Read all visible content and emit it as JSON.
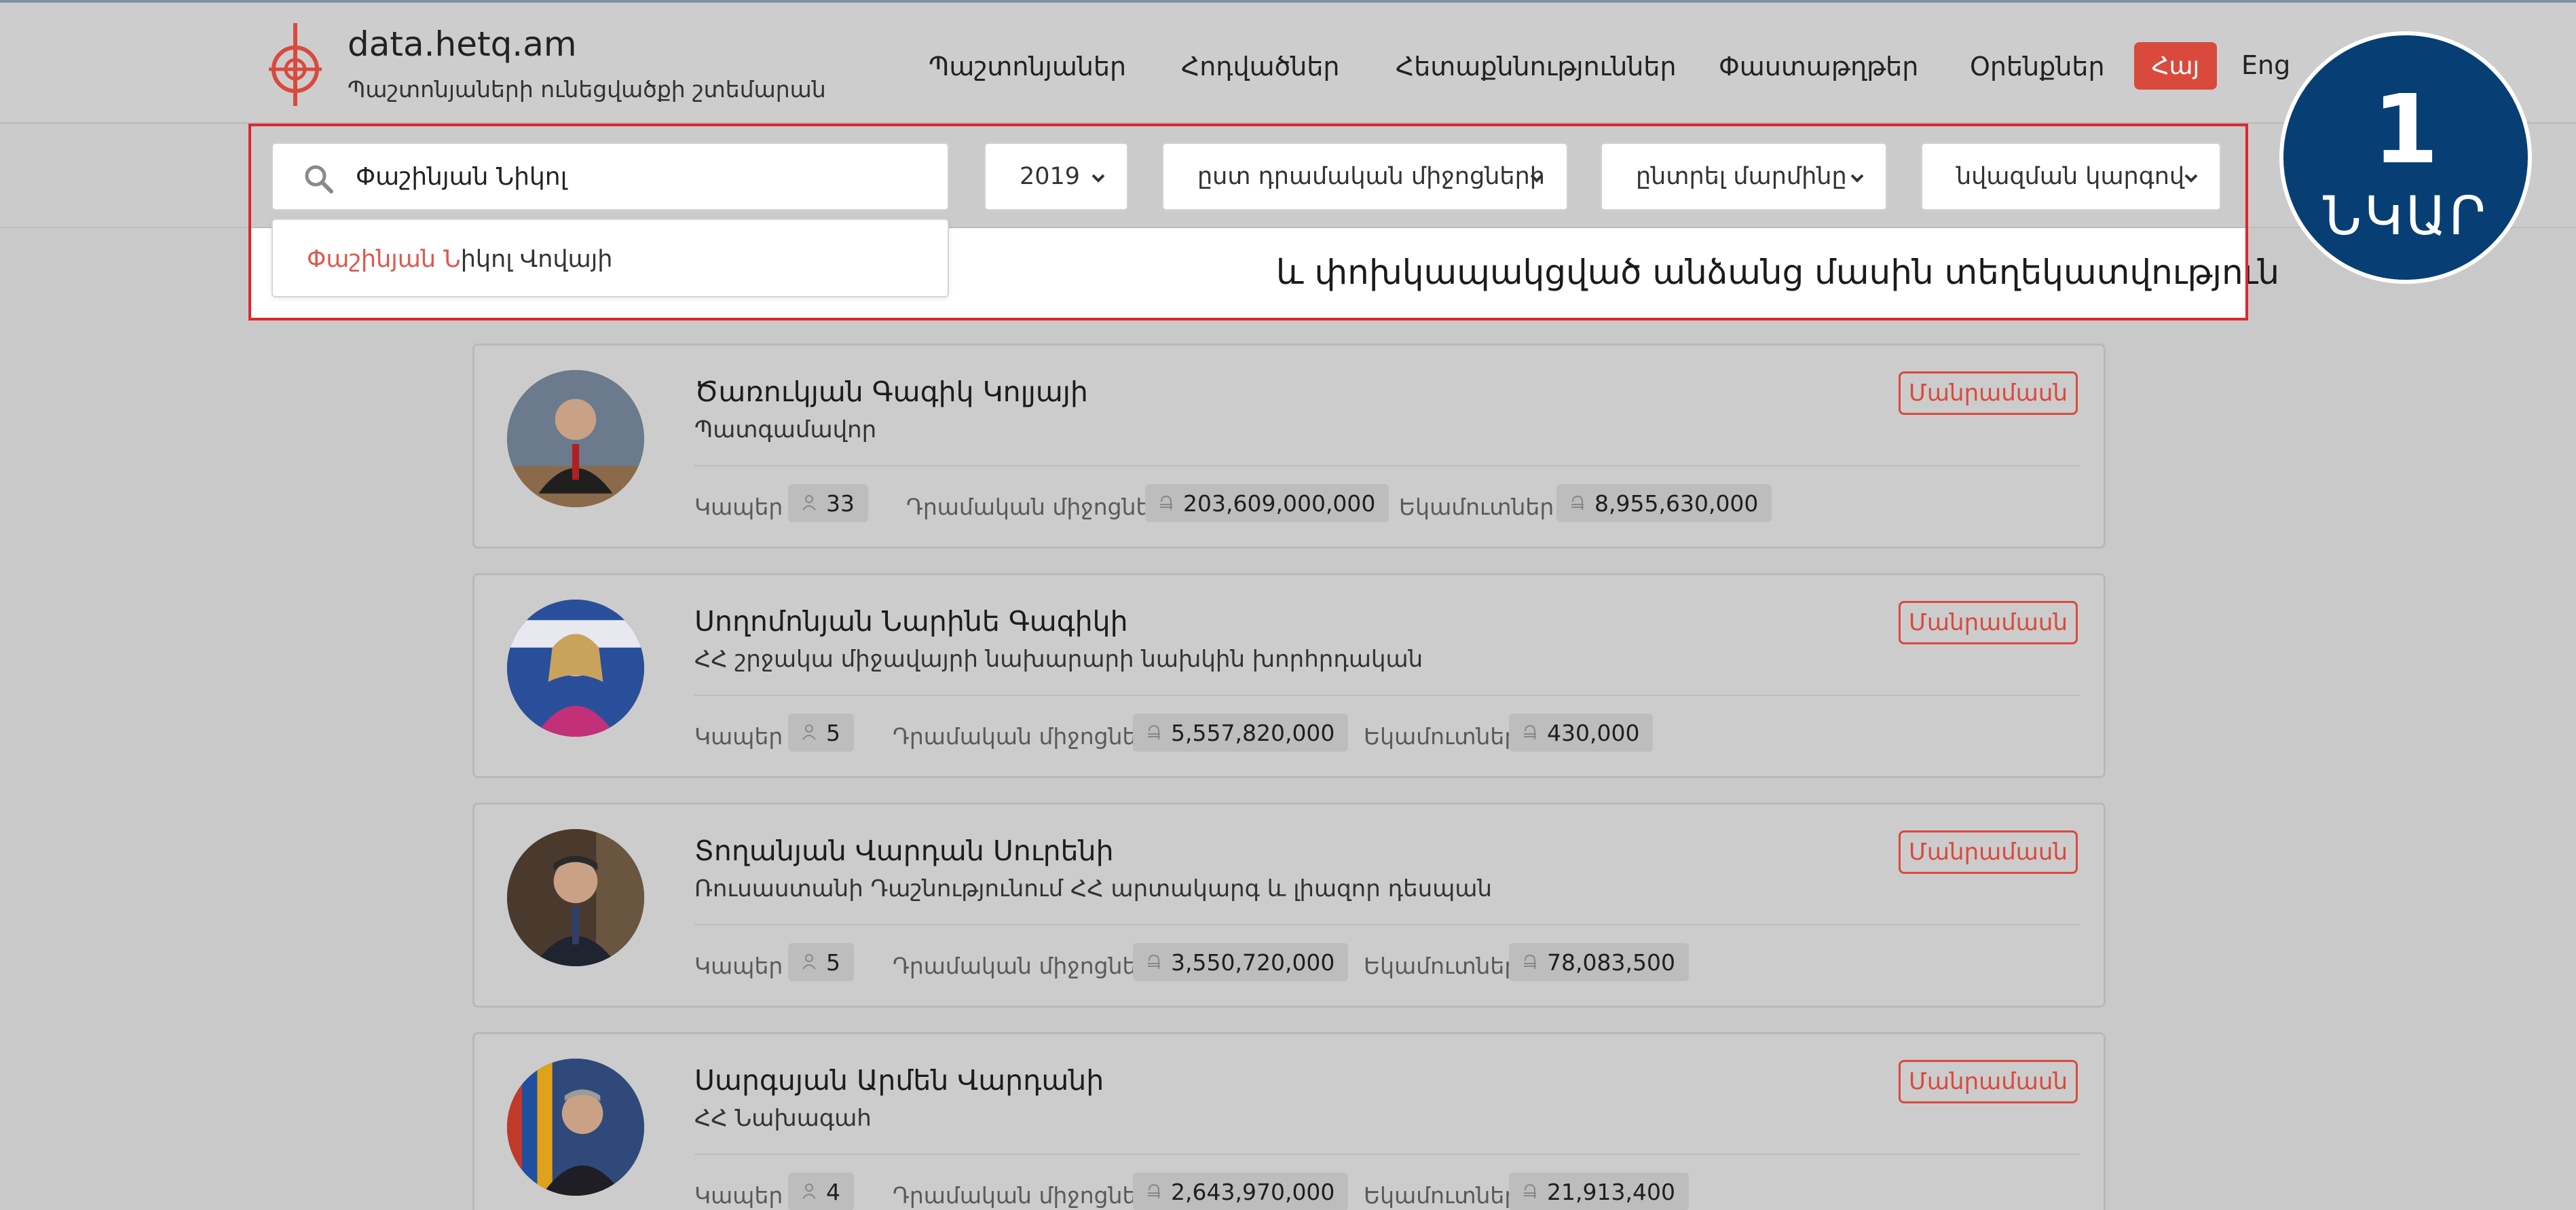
{
  "site": {
    "name": "data.hetq.am",
    "subtitle": "Պաշտոնյաների ունեցվածքի շտեմարան"
  },
  "nav": {
    "items": [
      "Պաշտոնյաներ",
      "Հոդվածներ",
      "Հետաքննություններ",
      "Փաստաթղթեր",
      "Օրենքներ"
    ],
    "lang_active": "Հայ",
    "lang_other": "Eng"
  },
  "filters": {
    "search_value": "Փաշինյան Նիկոլ",
    "year": "2019",
    "sort_by": "ըստ դրամական միջոցների",
    "body": "ընտրել մարմինը",
    "order": "նվազման կարգով"
  },
  "suggestion": {
    "highlight": "Փաշինյան Ն",
    "rest": "իկոլ Վովայի"
  },
  "section_title": "և փոխկապակցված անձանց մասին տեղեկատվություն",
  "badge": {
    "number": "1",
    "word": "ՆԿԱՐ"
  },
  "stat_labels": {
    "connections": "Կապեր",
    "cash": "Դրամական միջոցներ",
    "income": "Եկամուտներ"
  },
  "detail_label": "Մանրամասն",
  "people": [
    {
      "name": "Ծառուկյան Գագիկ Կոլյայի",
      "position": "Պատգամավոր",
      "connections": "33",
      "cash": "203,609,000,000",
      "income": "8,955,630,000"
    },
    {
      "name": "Սողոմոնյան Նարինե Գագիկի",
      "position": "ՀՀ շրջակա միջավայրի նախարարի նախկին խորհրդական",
      "connections": "5",
      "cash": "5,557,820,000",
      "income": "430,000"
    },
    {
      "name": "Տողանյան Վարդան Սուրենի",
      "position": "Ռուսաստանի Դաշնությունում ՀՀ արտակարգ և լիազոր դեսպան",
      "connections": "5",
      "cash": "3,550,720,000",
      "income": "78,083,500"
    },
    {
      "name": "Սարգսյան Արմեն Վարդանի",
      "position": "ՀՀ Նախագահ",
      "connections": "4",
      "cash": "2,643,970,000",
      "income": "21,913,400"
    }
  ],
  "colors": {
    "accent_red": "#d94a3d",
    "badge_blue": "#073f74",
    "highlight_border": "#e0262d"
  }
}
